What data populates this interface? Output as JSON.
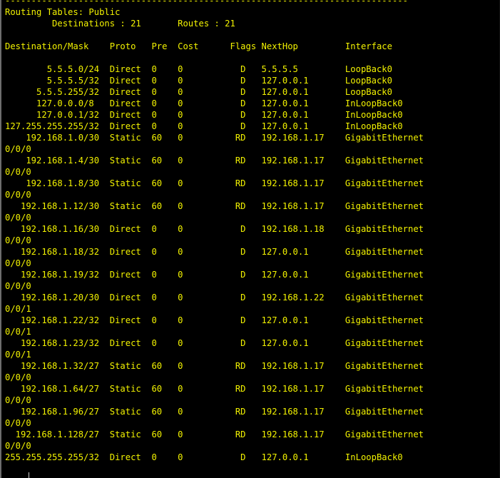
{
  "terminal": {
    "colors": {
      "background": "#000000",
      "text": "#f2f200",
      "cursor": "#cfcfcf"
    },
    "lines": [
      "-----------------------------------------------------------------------------",
      "Routing Tables: Public",
      "         Destinations : 21       Routes : 21",
      "",
      "Destination/Mask    Proto   Pre  Cost      Flags NextHop         Interface",
      "",
      "        5.5.5.0/24  Direct  0    0           D   5.5.5.5         LoopBack0",
      "        5.5.5.5/32  Direct  0    0           D   127.0.0.1       LoopBack0",
      "      5.5.5.255/32  Direct  0    0           D   127.0.0.1       LoopBack0",
      "      127.0.0.0/8   Direct  0    0           D   127.0.0.1       InLoopBack0",
      "      127.0.0.1/32  Direct  0    0           D   127.0.0.1       InLoopBack0",
      "127.255.255.255/32  Direct  0    0           D   127.0.0.1       InLoopBack0",
      "    192.168.1.0/30  Static  60   0          RD   192.168.1.17    GigabitEthernet",
      "0/0/0",
      "    192.168.1.4/30  Static  60   0          RD   192.168.1.17    GigabitEthernet",
      "0/0/0",
      "    192.168.1.8/30  Static  60   0          RD   192.168.1.17    GigabitEthernet",
      "0/0/0",
      "   192.168.1.12/30  Static  60   0          RD   192.168.1.17    GigabitEthernet",
      "0/0/0",
      "   192.168.1.16/30  Direct  0    0           D   192.168.1.18    GigabitEthernet",
      "0/0/0",
      "   192.168.1.18/32  Direct  0    0           D   127.0.0.1       GigabitEthernet",
      "0/0/0",
      "   192.168.1.19/32  Direct  0    0           D   127.0.0.1       GigabitEthernet",
      "0/0/0",
      "   192.168.1.20/30  Direct  0    0           D   192.168.1.22    GigabitEthernet",
      "0/0/1",
      "   192.168.1.22/32  Direct  0    0           D   127.0.0.1       GigabitEthernet",
      "0/0/1",
      "   192.168.1.23/32  Direct  0    0           D   127.0.0.1       GigabitEthernet",
      "0/0/1",
      "   192.168.1.32/27  Static  60   0          RD   192.168.1.17    GigabitEthernet",
      "0/0/0",
      "   192.168.1.64/27  Static  60   0          RD   192.168.1.17    GigabitEthernet",
      "0/0/0",
      "   192.168.1.96/27  Static  60   0          RD   192.168.1.17    GigabitEthernet",
      "0/0/0",
      "  192.168.1.128/27  Static  60   0          RD   192.168.1.17    GigabitEthernet",
      "0/0/0",
      "255.255.255.255/32  Direct  0    0           D   127.0.0.1       InLoopBack0"
    ]
  }
}
